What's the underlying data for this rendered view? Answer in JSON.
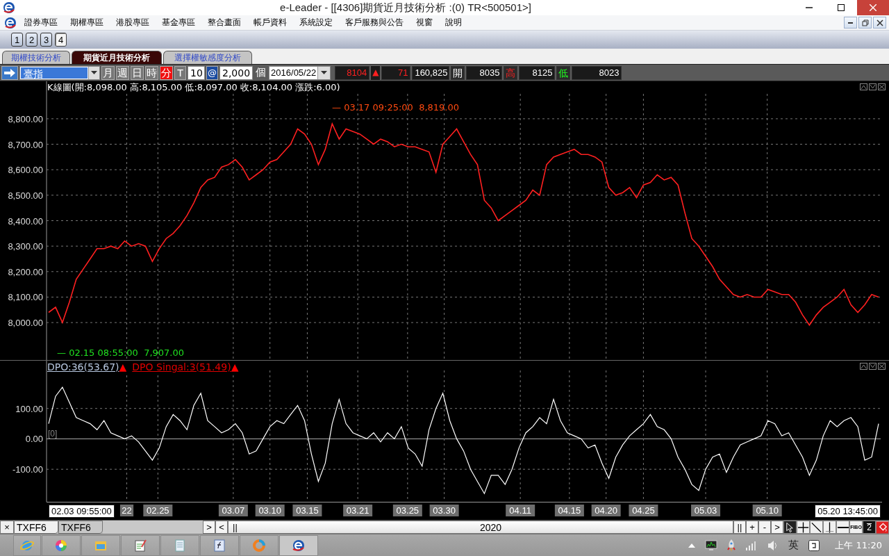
{
  "window": {
    "title": "e-Leader - [[4306]期貨近月技術分析 :(0) TR<500501>]"
  },
  "menu": {
    "items": [
      "證券專區",
      "期權專區",
      "港股專區",
      "基金專區",
      "整合畫面",
      "帳戶資料",
      "系統設定",
      "客戶服務與公告",
      "視窗",
      "說明"
    ]
  },
  "toolbar": {
    "buttons": [
      {
        "label": "1",
        "selected": false
      },
      {
        "label": "2",
        "selected": false
      },
      {
        "label": "3",
        "selected": false
      },
      {
        "label": "4",
        "selected": true
      }
    ]
  },
  "tabs": [
    {
      "label": "期權技術分析",
      "selected": false
    },
    {
      "label": "期貨近月技術分析",
      "selected": true
    },
    {
      "label": "選擇權敏感度分析",
      "selected": false
    }
  ],
  "controls": {
    "symbol": "臺指",
    "periods": [
      {
        "label": "月",
        "selected": false
      },
      {
        "label": "週",
        "selected": false
      },
      {
        "label": "日",
        "selected": false
      },
      {
        "label": "時",
        "selected": false
      },
      {
        "label": "分",
        "selected": true
      },
      {
        "label": "T",
        "selected": false
      }
    ],
    "interval": "10",
    "at": "@",
    "lot": "2,000",
    "unit": "個",
    "date": "2016/05/22"
  },
  "quote": [
    {
      "kind": "value",
      "text": "8104",
      "color": "#ff2020"
    },
    {
      "kind": "label",
      "text": "▲",
      "color": "#ff2020"
    },
    {
      "kind": "value",
      "text": "71",
      "color": "#ff2020"
    },
    {
      "kind": "value",
      "text": "160,825",
      "color": "#ffffff"
    },
    {
      "kind": "label",
      "text": "開",
      "color": "#ffffff"
    },
    {
      "kind": "value",
      "text": "8035",
      "color": "#ffffff"
    },
    {
      "kind": "label",
      "text": "高",
      "color": "#ff2020"
    },
    {
      "kind": "value",
      "text": "8125",
      "color": "#ffffff"
    },
    {
      "kind": "label",
      "text": "低",
      "color": "#20ff20"
    },
    {
      "kind": "value",
      "text": "8023",
      "color": "#ffffff"
    }
  ],
  "price_chart": {
    "header": "K線圖(開:8,098.00 高:8,105.00 低:8,097.00 收:8,104.00 漲跌:6.00)",
    "high_marker": "— 03.17 09:25:00  8,819.00",
    "low_marker": "— 02.15 08:55:00  7,907.00",
    "chart_data": {
      "type": "line",
      "grid": true,
      "ylim": [
        7853,
        8947
      ],
      "yticks": [
        {
          "value": 8000,
          "label": "8,000.00"
        },
        {
          "value": 8100,
          "label": "8,100.00"
        },
        {
          "value": 8200,
          "label": "8,200.00"
        },
        {
          "value": 8300,
          "label": "8,300.00"
        },
        {
          "value": 8400,
          "label": "8,400.00"
        },
        {
          "value": 8500,
          "label": "8,500.00"
        },
        {
          "value": 8600,
          "label": "8,600.00"
        },
        {
          "value": 8700,
          "label": "8,700.00"
        },
        {
          "value": 8800,
          "label": "8,800.00"
        }
      ],
      "series": [
        {
          "color": "#ff2020",
          "values": [
            8040,
            8060,
            8000,
            8080,
            8170,
            8210,
            8250,
            8290,
            8290,
            8300,
            8290,
            8320,
            8300,
            8310,
            8300,
            8240,
            8290,
            8330,
            8350,
            8380,
            8420,
            8470,
            8530,
            8560,
            8570,
            8610,
            8620,
            8640,
            8610,
            8560,
            8580,
            8600,
            8630,
            8640,
            8670,
            8700,
            8760,
            8740,
            8700,
            8620,
            8680,
            8780,
            8720,
            8760,
            8750,
            8740,
            8720,
            8700,
            8720,
            8710,
            8690,
            8700,
            8690,
            8690,
            8680,
            8670,
            8590,
            8700,
            8730,
            8760,
            8710,
            8660,
            8620,
            8480,
            8450,
            8400,
            8420,
            8440,
            8460,
            8480,
            8520,
            8500,
            8620,
            8650,
            8660,
            8670,
            8680,
            8660,
            8660,
            8650,
            8630,
            8530,
            8500,
            8510,
            8530,
            8490,
            8540,
            8550,
            8580,
            8560,
            8570,
            8540,
            8430,
            8330,
            8300,
            8260,
            8220,
            8170,
            8140,
            8110,
            8100,
            8110,
            8100,
            8100,
            8130,
            8120,
            8110,
            8110,
            8080,
            8030,
            7990,
            8030,
            8060,
            8080,
            8100,
            8130,
            8070,
            8040,
            8070,
            8110,
            8100
          ]
        }
      ]
    }
  },
  "dpo_chart": {
    "legend": [
      {
        "text": "DPO:36(53.67)",
        "kind": "indicator"
      },
      {
        "text": "▲",
        "kind": "arrow"
      },
      {
        "text": "DPO Singal:3(51.49)",
        "kind": "signal"
      },
      {
        "text": "▲",
        "kind": "arrow"
      }
    ],
    "zero_label": "[0]",
    "start_cursor": "02.03 09:55:00",
    "end_cursor": "05.20 13:45:00",
    "x_labels": [
      "22",
      "02.25",
      "03.07",
      "03.10",
      "03.15",
      "03.21",
      "03.25",
      "03.30",
      "04.11",
      "04.15",
      "04.20",
      "04.25",
      "05.03",
      "05.10"
    ],
    "chart_data": {
      "type": "line",
      "grid": true,
      "ylim": [
        -207,
        257
      ],
      "yticks": [
        {
          "value": -100,
          "label": "-100.00"
        },
        {
          "value": 0,
          "label": "0.00"
        },
        {
          "value": 100,
          "label": "100.00"
        }
      ],
      "series": [
        {
          "color": "#ffffff",
          "values": [
            50,
            140,
            170,
            120,
            70,
            60,
            50,
            30,
            60,
            20,
            10,
            0,
            10,
            -10,
            -40,
            -70,
            -30,
            40,
            80,
            60,
            30,
            110,
            150,
            60,
            40,
            20,
            30,
            50,
            20,
            -50,
            -40,
            0,
            40,
            60,
            50,
            80,
            110,
            60,
            -50,
            -140,
            -80,
            50,
            130,
            50,
            20,
            10,
            0,
            20,
            -10,
            20,
            0,
            40,
            -30,
            -50,
            -90,
            30,
            100,
            150,
            60,
            0,
            -40,
            -100,
            -140,
            -180,
            -120,
            -120,
            -150,
            -100,
            -30,
            20,
            40,
            70,
            50,
            130,
            60,
            20,
            10,
            0,
            -30,
            -20,
            -80,
            -130,
            -60,
            -20,
            10,
            30,
            50,
            80,
            40,
            30,
            0,
            -60,
            -100,
            -150,
            -170,
            -100,
            -60,
            -50,
            -110,
            -60,
            -20,
            -10,
            0,
            10,
            60,
            50,
            10,
            20,
            -20,
            -60,
            -120,
            -70,
            10,
            60,
            40,
            60,
            70,
            40,
            -70,
            -60,
            50
          ]
        }
      ]
    }
  },
  "bottom_bar": {
    "close": "×",
    "symbol_tabs": [
      {
        "label": "TXFF6",
        "selected": true
      },
      {
        "label": "TXFF6",
        "selected": false
      }
    ],
    "next": ">",
    "prev": "<",
    "thumb": "||",
    "year": "2020",
    "zoom_buttons": [
      "||",
      "+",
      "-",
      ">"
    ],
    "tools": [
      {
        "kind": "pointer",
        "selected": true
      },
      {
        "kind": "cross",
        "selected": false
      },
      {
        "kind": "diagonal",
        "selected": false
      },
      {
        "kind": "vertical",
        "selected": false
      },
      {
        "kind": "horizontal",
        "selected": false
      },
      {
        "kind": "fibo",
        "label": "FIBO",
        "selected": false
      },
      {
        "kind": "level",
        "label": "2",
        "selected": false
      },
      {
        "kind": "paint",
        "selected": false
      }
    ]
  },
  "taskbar": {
    "ime": "英",
    "clock": "上午 11:20"
  }
}
